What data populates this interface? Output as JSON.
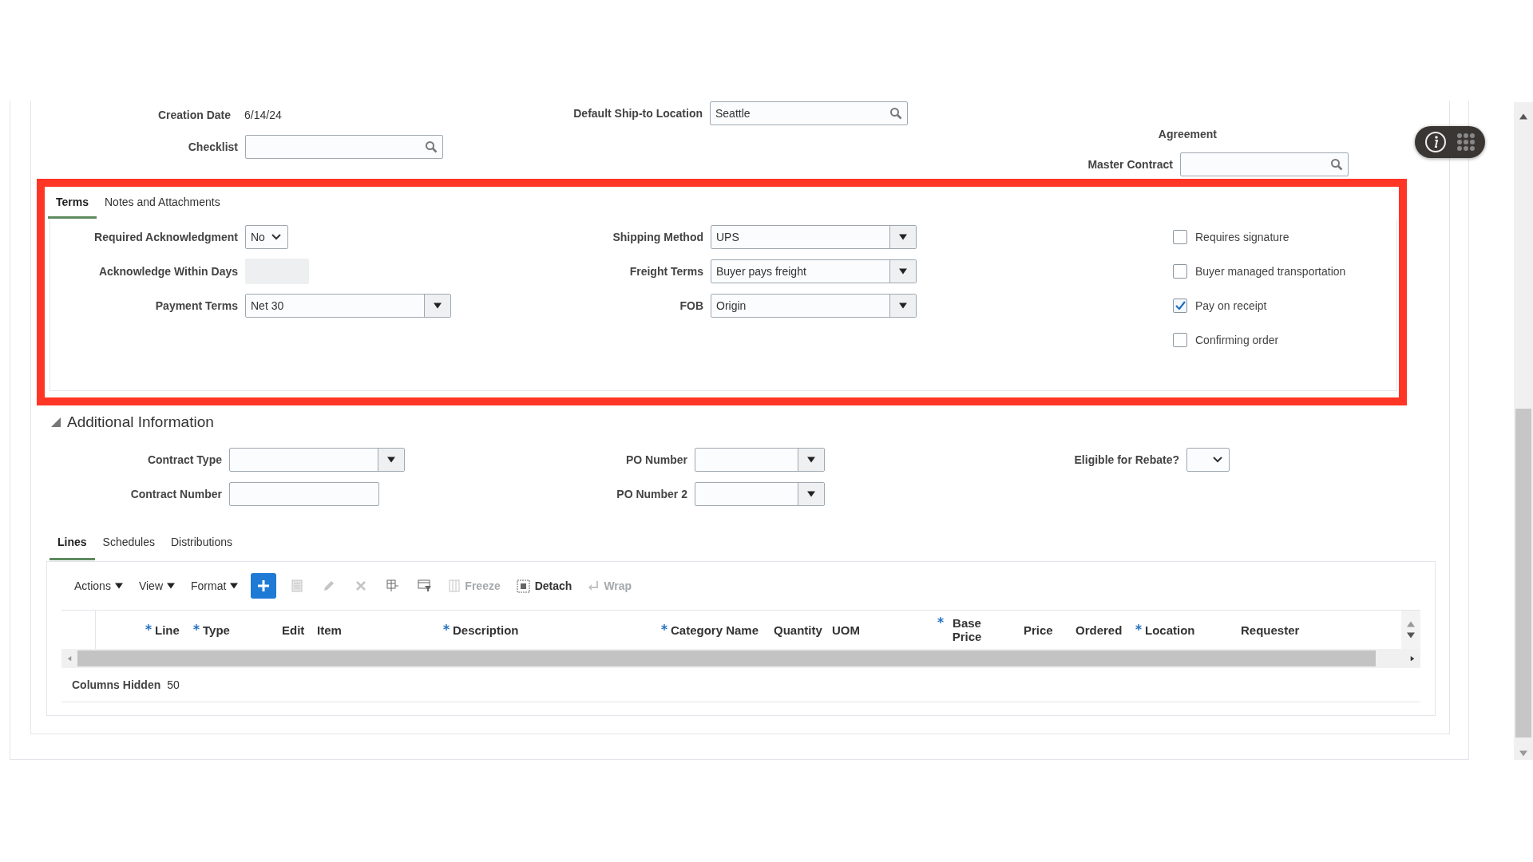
{
  "header_fields": {
    "creation_date": {
      "label": "Creation Date",
      "value": "6/14/24"
    },
    "checklist": {
      "label": "Checklist"
    },
    "ship_to": {
      "label": "Default Ship-to Location",
      "value": "Seattle"
    },
    "agreement": {
      "label": "Agreement"
    },
    "master_contract": {
      "label": "Master Contract"
    }
  },
  "detail_tabs": [
    {
      "label": "Terms",
      "selected": true
    },
    {
      "label": "Notes and Attachments",
      "selected": false
    }
  ],
  "terms": {
    "left": [
      {
        "kind": "select",
        "label": "Required Acknowledgment",
        "value": "No"
      },
      {
        "kind": "readonly",
        "label": "Acknowledge Within Days"
      },
      {
        "kind": "combo",
        "label": "Payment Terms",
        "value": "Net 30"
      }
    ],
    "middle": [
      {
        "kind": "combo",
        "label": "Shipping Method",
        "value": "UPS"
      },
      {
        "kind": "combo",
        "label": "Freight Terms",
        "value": "Buyer pays freight"
      },
      {
        "kind": "combo",
        "label": "FOB",
        "value": "Origin"
      }
    ],
    "checkboxes": [
      {
        "label": "Requires signature",
        "checked": false
      },
      {
        "label": "Buyer managed transportation",
        "checked": false
      },
      {
        "label": "Pay on receipt",
        "checked": true
      },
      {
        "label": "Confirming order",
        "checked": false
      }
    ]
  },
  "additional_information": {
    "title": "Additional Information",
    "expanded": true,
    "left": [
      {
        "kind": "combo",
        "label": "Contract Type"
      },
      {
        "kind": "text",
        "label": "Contract Number"
      }
    ],
    "middle": [
      {
        "kind": "combo",
        "label": "PO Number"
      },
      {
        "kind": "combo",
        "label": "PO Number 2"
      }
    ],
    "right": [
      {
        "kind": "select",
        "label": "Eligible for Rebate?"
      }
    ]
  },
  "line_tabs": [
    {
      "label": "Lines",
      "selected": true
    },
    {
      "label": "Schedules",
      "selected": false
    },
    {
      "label": "Distributions",
      "selected": false
    }
  ],
  "toolbar": {
    "menus": [
      "Actions",
      "View",
      "Format"
    ],
    "buttons": [
      {
        "kind": "primary",
        "disabled": false
      },
      {
        "kind": "icon",
        "disabled": true
      },
      {
        "kind": "icon",
        "disabled": true
      },
      {
        "kind": "icon",
        "disabled": true
      },
      {
        "kind": "icon",
        "disabled": false
      },
      {
        "kind": "icon",
        "disabled": false
      },
      {
        "kind": "text",
        "label": "Freeze",
        "disabled": true
      },
      {
        "kind": "text",
        "label": "Detach",
        "disabled": false
      },
      {
        "kind": "text",
        "label": "Wrap",
        "disabled": true
      }
    ]
  },
  "columns": [
    {
      "label": "Line",
      "required": true
    },
    {
      "label": "Type",
      "required": true
    },
    {
      "label": "Edit",
      "required": false
    },
    {
      "label": "Item",
      "required": false
    },
    {
      "label": "Description",
      "required": true
    },
    {
      "label": "Category Name",
      "required": true
    },
    {
      "label": "Quantity",
      "required": false
    },
    {
      "label": "UOM",
      "required": false
    },
    {
      "label": "Base Price",
      "required": true
    },
    {
      "label": "Price",
      "required": false
    },
    {
      "label": "Ordered",
      "required": false
    },
    {
      "label": "Location",
      "required": true
    },
    {
      "label": "Requester",
      "required": false
    }
  ],
  "footer": {
    "label": "Columns Hidden",
    "value": "50"
  }
}
